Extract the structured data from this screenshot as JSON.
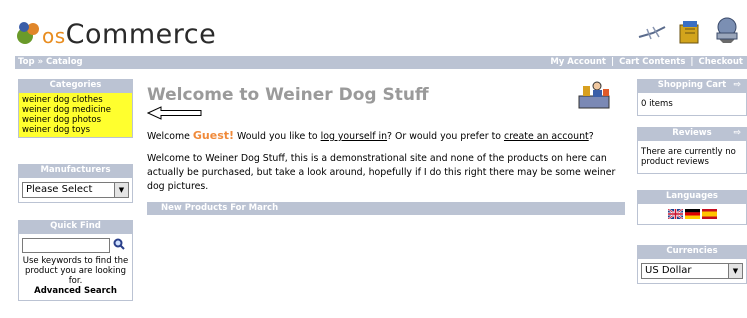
{
  "header": {
    "logo_prefix": "os",
    "logo_main": "Commerce",
    "icons": [
      "cart-arrow-icon",
      "box-icon",
      "globe-icon"
    ]
  },
  "nav": {
    "top": "Top",
    "sep1": "»",
    "catalog": "Catalog",
    "my_account": "My Account",
    "cart_contents": "Cart Contents",
    "checkout": "Checkout",
    "divider": "|"
  },
  "categories": {
    "title": "Categories",
    "items": [
      "weiner dog clothes",
      "weiner dog medicine",
      "weiner dog photos",
      "weiner dog toys"
    ]
  },
  "manufacturers": {
    "title": "Manufacturers",
    "selected": "Please Select"
  },
  "quick_find": {
    "title": "Quick Find",
    "help": "Use keywords to find the product you are looking for.",
    "advanced": "Advanced Search"
  },
  "main": {
    "title": "Welcome to Weiner Dog Stuff",
    "welcome_prefix": "Welcome",
    "guest": "Guest!",
    "welcome_mid": "Would you like to",
    "login_link": "log yourself in",
    "welcome_or": "? Or would you prefer to",
    "create_link": "create an account",
    "welcome_end": "?",
    "body": "Welcome to Weiner Dog Stuff, this is a demonstrational site and none of the products on here can actually be purchased, but take a look around, hopefully if I do this right there may be some weiner dog pictures.",
    "new_products": "New Products For March"
  },
  "shopping_cart": {
    "title": "Shopping Cart",
    "content": "0 items"
  },
  "reviews": {
    "title": "Reviews",
    "content": "There are currently no product reviews"
  },
  "languages": {
    "title": "Languages",
    "flags": [
      "english-flag",
      "german-flag",
      "spanish-flag"
    ]
  },
  "currencies": {
    "title": "Currencies",
    "selected": "US Dollar"
  },
  "colors": {
    "box_header": "#bbc3d3",
    "categories_bg": "#ffff2e",
    "guest": "#f08a3a",
    "title": "#9a9a9a"
  }
}
